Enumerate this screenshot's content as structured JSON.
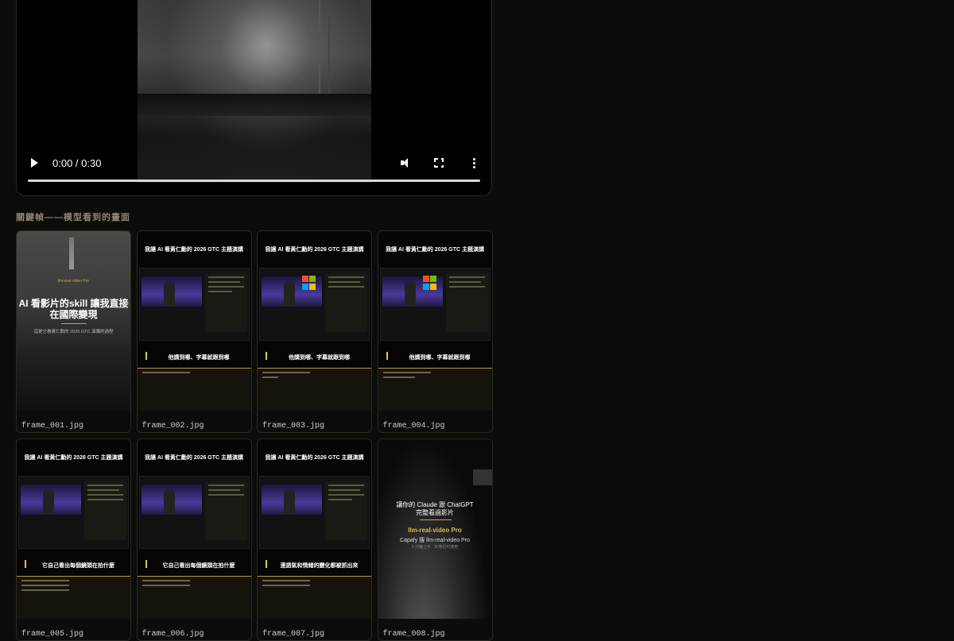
{
  "player": {
    "time": "0:00 / 0:30",
    "progress": 0
  },
  "section_title": "關鍵幀——模型看到的畫面",
  "frames": [
    {
      "file": "frame_001.jpg",
      "brand": "llm-real-video Pro",
      "headline": "AI 看影片的skill 讓我直接在國際變現",
      "sub": "這是它看黃仁勳的 2026 GTC 演講的過程"
    },
    {
      "file": "frame_002.jpg",
      "header": "我讓 AI 看黃仁勳的 2026 GTC 主題演講",
      "subtitle": "他講到哪、字幕就跟到哪"
    },
    {
      "file": "frame_003.jpg",
      "header": "我讓 AI 看黃仁勳的 2026 GTC 主題演講",
      "subtitle": "他講到哪、字幕就跟到哪"
    },
    {
      "file": "frame_004.jpg",
      "header": "我讓 AI 看黃仁勳的 2026 GTC 主題演講",
      "subtitle": "他講到哪、字幕就跟到哪"
    },
    {
      "file": "frame_005.jpg",
      "header": "我讓 AI 看黃仁勳的 2026 GTC 主題演講",
      "subtitle": "它自己看出每個鏡頭在拍什麼"
    },
    {
      "file": "frame_006.jpg",
      "header": "我讓 AI 看黃仁勳的 2026 GTC 主題演講",
      "subtitle": "它自己看出每個鏡頭在拍什麼"
    },
    {
      "file": "frame_007.jpg",
      "header": "我讓 AI 看黃仁勳的 2026 GTC 主題演講",
      "subtitle": "連語氣和情緒的變化都被抓出來"
    },
    {
      "file": "frame_008.jpg",
      "line1": "讓你的 Claude 跟 ChatGPT",
      "line2": "完整看過影片",
      "product": "llm-real-video Pro",
      "line3": "Capafy 搜 llm-real-video Pro",
      "line4": "3 分鐘上手 · 本地也可使用"
    }
  ],
  "colors": {
    "accent": "#e6c14a",
    "background": "#0d0c0a"
  }
}
